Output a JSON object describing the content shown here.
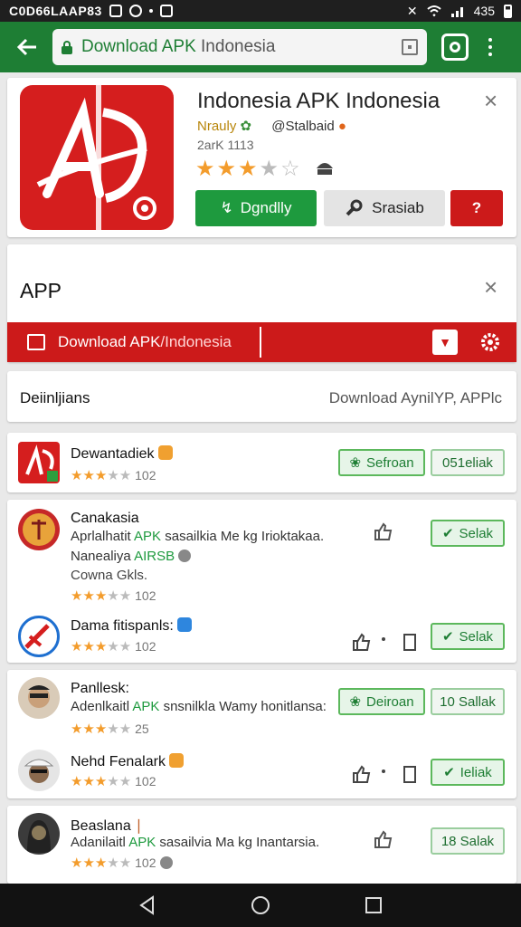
{
  "status_bar": {
    "carrier": "C0D66LAAP83",
    "battery": "435"
  },
  "toolbar": {
    "url_main": "Download APK",
    "url_host": "Indonesia"
  },
  "header": {
    "title": "Indonesia APK Indonesia",
    "developer": "Nrauly",
    "handle": "@Stalbaid",
    "meta": "2arK 1113",
    "rating": 3,
    "buttons": {
      "download": "Dgndlly",
      "search": "Srasiab",
      "help": "?"
    }
  },
  "app_section": {
    "label": "APP",
    "bar_main": "Download APK",
    "bar_host": "/Indonesia"
  },
  "definitions": {
    "left": "Deiinljians",
    "right": "Download AynilYP, APPlc"
  },
  "rows": [
    {
      "title": "Dewantadiek",
      "rating_count": "102",
      "actions": [
        "Sefroan",
        "051eliak"
      ]
    },
    {
      "title": "Canakasia",
      "sub_pre": "Aprlalhatit ",
      "sub_apk": "APK",
      "sub_post": " sasailkia Me kg Irioktakaa.",
      "line3_pre": "Nanealiya ",
      "line3_green": "AIRSB",
      "line4": "Cowna Gkls.",
      "rating_count": "102",
      "action": "Selak"
    },
    {
      "title": "Dama fitispanls:",
      "rating_count": "102",
      "action": "Selak"
    },
    {
      "title": "Panllesk:",
      "sub_pre": "Adenlkaitl ",
      "sub_apk": "APK",
      "sub_post": " snsnilkla Wamy honitlansa:",
      "rating_count": "25",
      "actions": [
        "Deiroan",
        "10 Sallak"
      ]
    },
    {
      "title": "Nehd Fenalark",
      "rating_count": "102",
      "action": "Ieliak"
    },
    {
      "title": "Beaslana",
      "sub_pre": "Adanilaitl ",
      "sub_apk": "APK",
      "sub_post": " sasailvia Ma kg Inantarsia.",
      "rating_count": "102",
      "action": "18 Salak"
    }
  ],
  "colors": {
    "brand_green": "#1e7e34",
    "accent_red": "#cc1a1a",
    "star": "#f39c2c"
  }
}
